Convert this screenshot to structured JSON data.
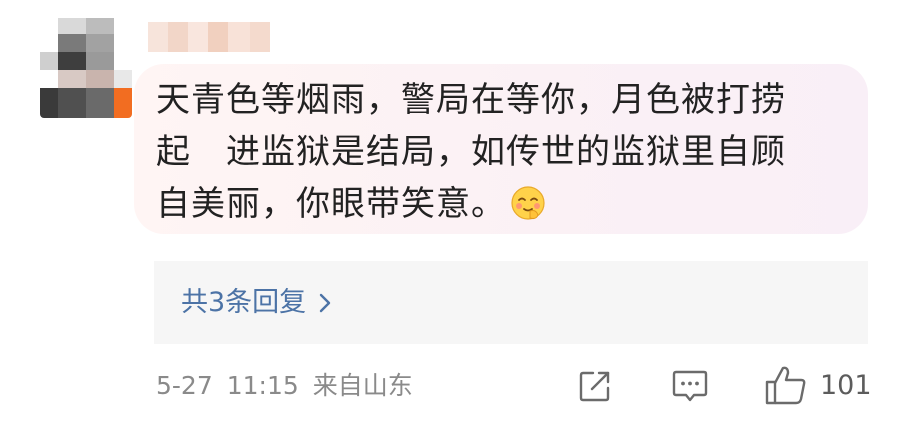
{
  "comment": {
    "text_lines": [
      "天青色等烟雨，警局在等你，月色被打捞",
      "起　进监狱是结局，如传世的监狱里自顾",
      "自美丽，你眼带笑意。"
    ],
    "emoji": "blush-hand-emoji"
  },
  "replies": {
    "label": "共3条回复",
    "chevron": "chevron-right-icon"
  },
  "meta": {
    "date": "5-27",
    "time": "11:15",
    "source": "来自山东"
  },
  "actions": {
    "share_icon": "share-icon",
    "comment_icon": "comment-icon",
    "like_icon": "thumbs-up-icon",
    "like_count": "101"
  },
  "colors": {
    "link": "#4c73a6",
    "meta": "#8a8a8a",
    "bubble": "#fbf1f5",
    "reply_bg": "#f6f6f6"
  }
}
